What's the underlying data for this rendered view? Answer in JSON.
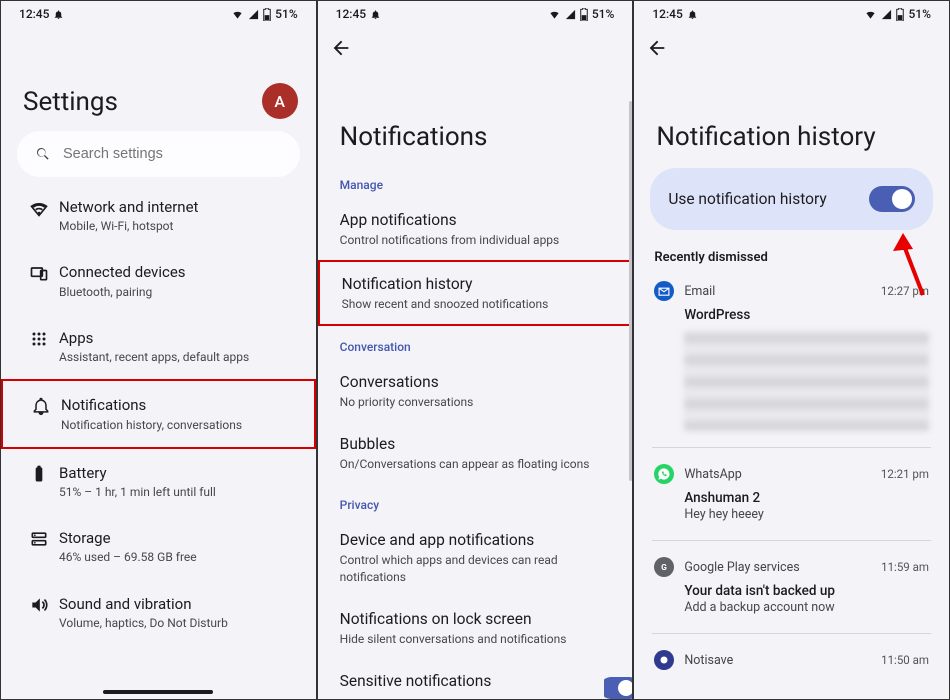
{
  "status": {
    "time": "12:45",
    "battery": "51%"
  },
  "avatar_letter": "A",
  "screen1": {
    "title": "Settings",
    "search_placeholder": "Search settings",
    "items": [
      {
        "icon": "wifi",
        "title": "Network and internet",
        "sub": "Mobile, Wi-Fi, hotspot"
      },
      {
        "icon": "devices",
        "title": "Connected devices",
        "sub": "Bluetooth, pairing"
      },
      {
        "icon": "apps",
        "title": "Apps",
        "sub": "Assistant, recent apps, default apps"
      },
      {
        "icon": "bell",
        "title": "Notifications",
        "sub": "Notification history, conversations"
      },
      {
        "icon": "battery",
        "title": "Battery",
        "sub": "51% – 1 hr, 1 min left until full"
      },
      {
        "icon": "storage",
        "title": "Storage",
        "sub": "46% used – 69.58 GB free"
      },
      {
        "icon": "sound",
        "title": "Sound and vibration",
        "sub": "Volume, haptics, Do Not Disturb"
      }
    ]
  },
  "screen2": {
    "title": "Notifications",
    "sections": [
      {
        "header": "Manage",
        "rows": [
          {
            "title": "App notifications",
            "sub": "Control notifications from individual apps"
          },
          {
            "title": "Notification history",
            "sub": "Show recent and snoozed notifications",
            "highlight": true
          }
        ]
      },
      {
        "header": "Conversation",
        "rows": [
          {
            "title": "Conversations",
            "sub": "No priority conversations"
          },
          {
            "title": "Bubbles",
            "sub": "On/Conversations can appear as floating icons"
          }
        ]
      },
      {
        "header": "Privacy",
        "rows": [
          {
            "title": "Device and app notifications",
            "sub": "Control which apps and devices can read notifications"
          },
          {
            "title": "Notifications on lock screen",
            "sub": "Hide silent conversations and notifications"
          },
          {
            "title": "Sensitive notifications",
            "sub": ""
          }
        ]
      }
    ]
  },
  "screen3": {
    "title": "Notification history",
    "toggle_label": "Use notification history",
    "toggle_on": true,
    "dismissed_header": "Recently dismissed",
    "notifications": [
      {
        "app": "Email",
        "icon": "mail",
        "time": "12:27 pm",
        "title": "WordPress",
        "blurred": true
      },
      {
        "app": "WhatsApp",
        "icon": "wa",
        "time": "12:21 pm",
        "title": "Anshuman 2",
        "text": "Hey hey heeey"
      },
      {
        "app": "Google Play services",
        "icon": "gp",
        "time": "11:59 am",
        "title": "Your data isn't backed up",
        "text": "Add a backup account now"
      },
      {
        "app": "Notisave",
        "icon": "ns",
        "time": "11:50 am"
      }
    ]
  }
}
